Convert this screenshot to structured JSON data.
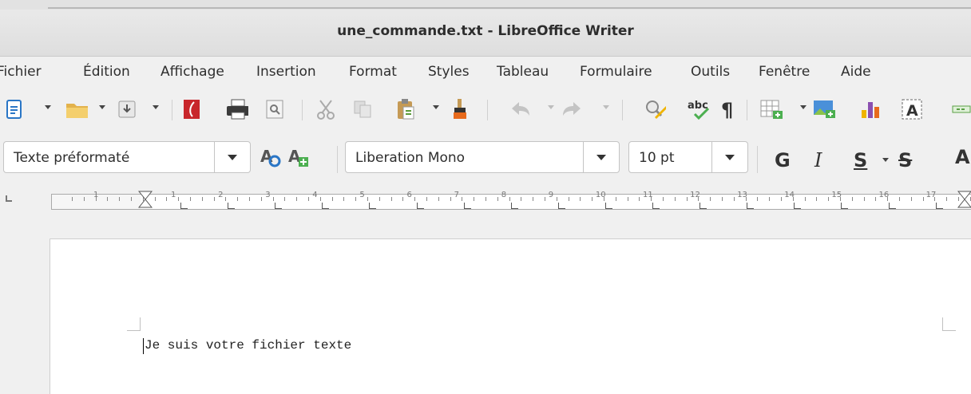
{
  "window": {
    "title": "une_commande.txt - LibreOffice Writer"
  },
  "menu": {
    "items": [
      "Fichier",
      "Édition",
      "Affichage",
      "Insertion",
      "Format",
      "Styles",
      "Tableau",
      "Formulaire",
      "Outils",
      "Fenêtre",
      "Aide"
    ]
  },
  "toolbar": {
    "icons": [
      "new-document-icon",
      "open-folder-icon",
      "save-icon",
      "export-pdf-icon",
      "print-icon",
      "print-preview-icon",
      "cut-icon",
      "copy-icon",
      "paste-icon",
      "clone-formatting-icon",
      "undo-icon",
      "redo-icon",
      "find-replace-icon",
      "spellcheck-icon",
      "formatting-marks-icon",
      "insert-table-icon",
      "insert-image-icon",
      "insert-chart-icon",
      "insert-textbox-icon",
      "insert-field-icon"
    ]
  },
  "formatting": {
    "paragraph_style": "Texte préformaté",
    "font_name": "Liberation Mono",
    "font_size": "10 pt",
    "bold_label": "G",
    "italic_label": "I",
    "underline_label": "S",
    "strike_label": "S"
  },
  "ruler": {
    "labels": [
      "1",
      "1",
      "2",
      "3",
      "4",
      "5",
      "6",
      "7",
      "8",
      "9",
      "10",
      "11",
      "12",
      "13",
      "14",
      "15",
      "16",
      "17"
    ]
  },
  "document": {
    "text": "Je suis votre fichier texte"
  },
  "colors": {
    "accent_blue": "#2a76c6",
    "pdf_red": "#c8262b",
    "chart_purple": "#8a4fb0"
  }
}
